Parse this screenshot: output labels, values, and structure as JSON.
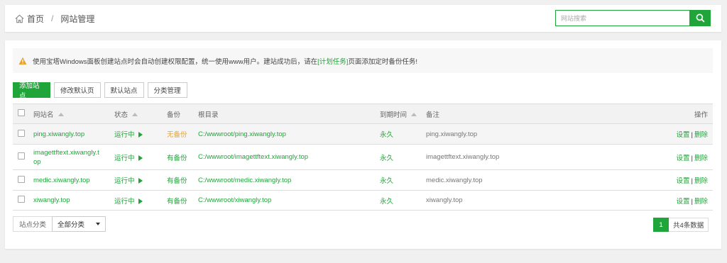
{
  "breadcrumb": {
    "home": "首页",
    "separator": "/",
    "current": "网站管理"
  },
  "search": {
    "placeholder": "网站搜索",
    "value": ""
  },
  "notice": {
    "text_before": "使用宝塔Windows面板创建站点时会自动创建权限配置，统一使用www用户。建站成功后，请在",
    "link": "[计划任务]",
    "text_after": "页面添加定时备份任务!"
  },
  "toolbar": {
    "add_site": "添加站点",
    "edit_default_page": "修改默认页",
    "default_site": "默认站点",
    "category_manage": "分类管理"
  },
  "table": {
    "headers": {
      "name": "网站名",
      "status": "状态",
      "backup": "备份",
      "root": "根目录",
      "expire": "到期时间",
      "remark": "备注",
      "actions": "操作"
    },
    "rows": [
      {
        "name": "ping.xiwangly.top",
        "status": "运行中",
        "backup": "无备份",
        "root": "C:/wwwroot/ping.xiwangly.top",
        "expire": "永久",
        "remark": "ping.xiwangly.top",
        "settings": "设置",
        "delete": "删除"
      },
      {
        "name_line1": "imagettftext.xiwangly.t",
        "name_line2": "op",
        "status": "运行中",
        "backup": "有备份",
        "root": "C:/wwwroot/imagettftext.xiwangly.top",
        "expire": "永久",
        "remark": "imagettftext.xiwangly.top",
        "settings": "设置",
        "delete": "删除"
      },
      {
        "name": "medic.xiwangly.top",
        "status": "运行中",
        "backup": "有备份",
        "root": "C:/wwwroot/medic.xiwangly.top",
        "expire": "永久",
        "remark": "medic.xiwangly.top",
        "settings": "设置",
        "delete": "删除"
      },
      {
        "name": "xiwangly.top",
        "status": "运行中",
        "backup": "有备份",
        "root": "C:/wwwroot/xiwangly.top",
        "expire": "永久",
        "remark": "xiwangly.top",
        "settings": "设置",
        "delete": "删除"
      }
    ]
  },
  "category_filter": {
    "label": "站点分类",
    "selected": "全部分类"
  },
  "pagination": {
    "current_page": "1",
    "total_text": "共4条数据"
  },
  "colors": {
    "accent": "#20a53a",
    "warning": "#e8a22c",
    "no_backup": "#e8a22c"
  },
  "icons": {
    "home": "home-icon",
    "search": "search-icon",
    "warning": "warning-icon"
  }
}
